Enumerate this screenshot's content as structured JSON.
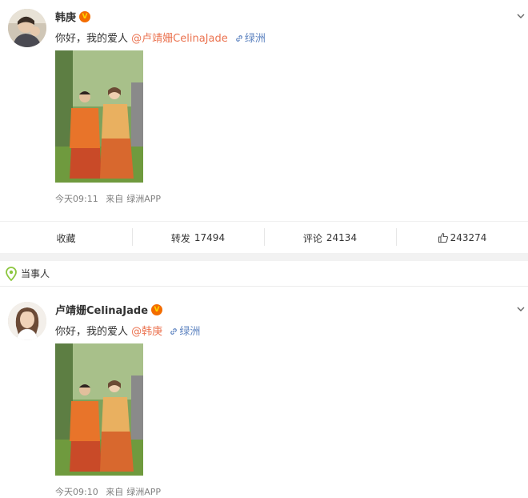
{
  "post1": {
    "username": "韩庚",
    "verified_badge": "V",
    "text": "你好，我的爱人",
    "mention": "@卢靖姗CelinaJade",
    "location_link": "绿洲",
    "time": "今天09:11",
    "source_prefix": "来自",
    "source": "绿洲APP"
  },
  "actions": {
    "favorite_label": "收藏",
    "repost_label": "转发",
    "repost_count": "17494",
    "comment_label": "评论",
    "comment_count": "24134",
    "like_count": "243274"
  },
  "party_section": {
    "label": "当事人"
  },
  "post2": {
    "username": "卢靖姗CelinaJade",
    "verified_badge": "V",
    "text": "你好，我的爱人",
    "mention": "@韩庚",
    "location_link": "绿洲",
    "time": "今天09:10",
    "source_prefix": "来自",
    "source": "绿洲APP"
  },
  "colors": {
    "mention": "#eb7350",
    "link_blue": "#5d83c0",
    "meta_gray": "#808080",
    "badge_orange": "#f36c00",
    "location_green": "#8cc63f"
  }
}
